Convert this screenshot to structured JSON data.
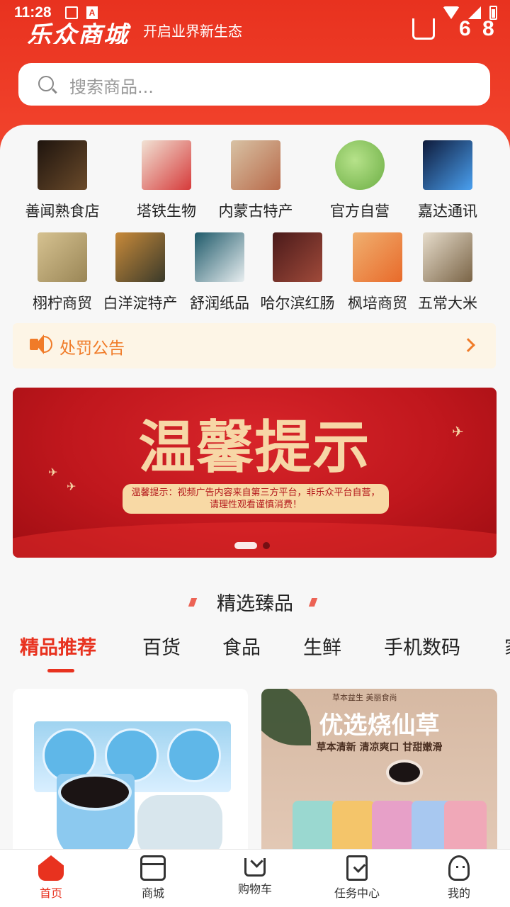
{
  "status_bar": {
    "time": "11:28",
    "notification_icons": [
      "image-icon",
      "a-icon"
    ],
    "right_icons": [
      "wifi-icon",
      "signal-icon",
      "battery-icon"
    ]
  },
  "header": {
    "brand": "乐众商城",
    "slogan": "开启业界新生态",
    "message_glyph": "6 8",
    "bg_color": "#e8321f"
  },
  "search": {
    "placeholder": "搜索商品..."
  },
  "shops": [
    {
      "label": "善闻熟食店",
      "thumb_color": "#3a2a1e"
    },
    {
      "label": "塔铁生物",
      "thumb_color": "#d63a3a"
    },
    {
      "label": "内蒙古特产",
      "thumb_color": "#c9a27a"
    },
    {
      "label": "官方自营",
      "thumb_color": "#7cc05a"
    },
    {
      "label": "嘉达通讯",
      "thumb_color": "#2a6fd0"
    },
    {
      "label": "栩柠商贸",
      "thumb_color": "#b8a06a"
    },
    {
      "label": "白洋淀特产",
      "thumb_color": "#4a5a3a"
    },
    {
      "label": "舒润纸品",
      "thumb_color": "#2d6a7a"
    },
    {
      "label": "哈尔滨红肠",
      "thumb_color": "#6a2a2a"
    },
    {
      "label": "枫培商贸",
      "thumb_color": "#e89a4a"
    },
    {
      "label": "五常大米",
      "thumb_color": "#a8906e"
    }
  ],
  "notice": {
    "label": "处罚公告",
    "color": "#f07b28"
  },
  "banner": {
    "title": "温馨提示",
    "note": "温馨提示：视频广告内容来自第三方平台，非乐众平台自营，请理性观看谨慎消费！",
    "slides": 2,
    "active_slide": 1
  },
  "section": {
    "title": "精选臻品"
  },
  "category_tabs": [
    {
      "label": "精品推荐",
      "active": true
    },
    {
      "label": "百货",
      "active": false
    },
    {
      "label": "食品",
      "active": false
    },
    {
      "label": "生鲜",
      "active": false
    },
    {
      "label": "手机数码",
      "active": false
    },
    {
      "label": "家",
      "active": false
    }
  ],
  "products": [
    {
      "name": "烧仙草 product image"
    },
    {
      "tag": "草本益生 美丽食尚",
      "title": "优选烧仙草",
      "subtitle": "草本清新 清凉爽口 甘甜嫩滑"
    }
  ],
  "tabbar": [
    {
      "label": "首页",
      "icon": "home-icon",
      "active": true
    },
    {
      "label": "商城",
      "icon": "store-icon",
      "active": false
    },
    {
      "label": "购物车",
      "icon": "cart-icon",
      "active": false
    },
    {
      "label": "任务中心",
      "icon": "task-icon",
      "active": false
    },
    {
      "label": "我的",
      "icon": "user-icon",
      "active": false
    }
  ],
  "colors": {
    "accent": "#e8321f",
    "notice": "#f07b28",
    "banner_text": "#f7d7a6"
  }
}
